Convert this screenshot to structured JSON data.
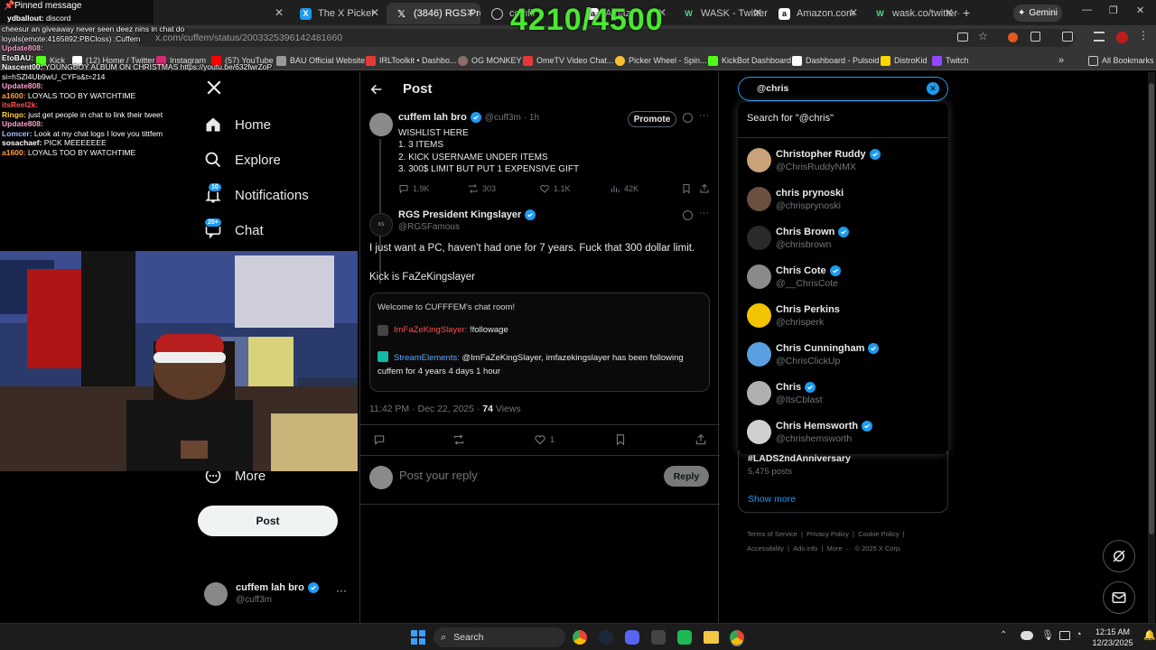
{
  "browser": {
    "tabs": [
      {
        "label": ""
      },
      {
        "label": "The X Picker"
      },
      {
        "label": "(3846) RGS Pres"
      },
      {
        "label": "coinfli"
      },
      {
        "label": "Amaz"
      },
      {
        "label": "WASK - Twitter"
      },
      {
        "label": "Amazon.com"
      },
      {
        "label": "wask.co/twitter-"
      }
    ],
    "gemini_label": "Gemini",
    "url": "x.com/cuffem/status/2003325396142481660",
    "bookmarks": [
      "Kick",
      "(12) Home / Twitter",
      "Instagram",
      "(57) YouTube",
      "BAU Official Website",
      "IRLToolkit • Dashbo...",
      "OG MONKEY",
      "OmeTV Video Chat...",
      "Picker Wheel - Spin...",
      "KickBot Dashboard",
      "Dashboard - Pulsoid",
      "DistroKid",
      "Twitch"
    ],
    "all_bookmarks": "All Bookmarks"
  },
  "overlay": {
    "counter": "4210/4500",
    "pinned_label": "Pinned message",
    "pinned_user": "ydballout:",
    "pinned_text": "discord",
    "chat": [
      {
        "user": "",
        "text": "cheesur an giveaway never seen deez nins in chat do",
        "color": "#ffffff"
      },
      {
        "user": "",
        "text": "loyals(emote:4165892:PBCloss) :Cuffem",
        "color": "#ffffff"
      },
      {
        "user": "Update808:",
        "text": "",
        "color": "#ff9fcf"
      },
      {
        "user": "EtoBAU:",
        "text": "",
        "color": "#ffffff"
      },
      {
        "user": "Nascent00:",
        "text": "YOUNGBOY ALBUM ON CHRISTMAS https://youtu.be/632fwrZoPIQ?",
        "color": "#ffffff"
      },
      {
        "user": "",
        "text": "si=hSZl4Ub9wU_CYFs&t=214",
        "color": "#ffffff"
      },
      {
        "user": "Update808:",
        "text": "",
        "color": "#ff9fcf"
      },
      {
        "user": "a1600:",
        "text": "LOYALS TOO BY WATCHTIME",
        "color": "#ff9f40"
      },
      {
        "user": "itsReel2k:",
        "text": "",
        "color": "#ff5050"
      },
      {
        "user": "Ringo:",
        "text": "just get people in chat to link their tweet",
        "color": "#ffd040"
      },
      {
        "user": "Update808:",
        "text": "",
        "color": "#ff9fcf"
      },
      {
        "user": "Lomcer:",
        "text": "Look at my chat logs I love you tittfem",
        "color": "#9fc0ff"
      },
      {
        "user": "sosachaef:",
        "text": "PICK MEEEEEEE",
        "color": "#ffffff"
      },
      {
        "user": "a1600:",
        "text": "LOYALS TOO BY WATCHTIME",
        "color": "#ff9f40"
      }
    ]
  },
  "sidebar": {
    "items": [
      {
        "label": "Home",
        "icon": "home-icon"
      },
      {
        "label": "Explore",
        "icon": "search-icon"
      },
      {
        "label": "Notifications",
        "icon": "bell-icon",
        "badge": "10"
      },
      {
        "label": "Chat",
        "icon": "chat-icon",
        "badge": "20+"
      },
      {
        "label": "More",
        "icon": "more-circle-icon"
      }
    ],
    "post_button": "Post",
    "account": {
      "name": "cuffem lah bro",
      "handle": "@cuff3m"
    }
  },
  "post": {
    "header": "Post",
    "parent": {
      "name": "cuffem lah bro",
      "handle": "@cuff3m",
      "time": "· 1h",
      "promote": "Promote",
      "lines": [
        "WISHLIST HERE",
        "1. 3 ITEMS",
        "2. KICK USERNAME UNDER ITEMS",
        "3. 300$ LIMIT BUT PUT 1 EXPENSIVE GIFT"
      ],
      "replies": "1.9K",
      "reposts": "303",
      "likes": "1.1K",
      "views": "42K"
    },
    "main": {
      "name": "RGS President Kingslayer",
      "handle": "@RGSFamous",
      "text1": "I just want a PC, haven't had one for 7 years. Fuck that 300 dollar limit.",
      "text2": "Kick is FaZeKingslayer",
      "embed": {
        "title": "Welcome to CUFFFEM's chat room!",
        "user1": "ImFaZeKingSlayer:",
        "msg1": "!followage",
        "user2": "StreamElements:",
        "msg2": "@ImFaZeKingSlayer, imfazekingslayer has been following cuffem for  4 years 4 days 1 hour"
      },
      "timestamp": "11:42 PM · Dec 22, 2025 · ",
      "views": "74",
      "views_label": "Views",
      "likes": "1"
    },
    "reply_placeholder": "Post your reply",
    "reply_button": "Reply"
  },
  "search": {
    "query": "@chris",
    "search_for": "Search for \"@chris\"",
    "results": [
      {
        "name": "Christopher Ruddy",
        "handle": "@ChrisRuddyNMX",
        "verified": true,
        "color": "#c9a27a"
      },
      {
        "name": "chris prynoski",
        "handle": "@chrisprynoski",
        "verified": false,
        "color": "#6b5040"
      },
      {
        "name": "Chris Brown",
        "handle": "@chrisbrown",
        "verified": true,
        "color": "#2a2a2a"
      },
      {
        "name": "Chris Cote",
        "handle": "@__ChrisCote",
        "verified": true,
        "color": "#8a8a8a"
      },
      {
        "name": "Chris Perkins",
        "handle": "@chrisperk",
        "verified": false,
        "color": "#f2c400"
      },
      {
        "name": "Chris Cunningham",
        "handle": "@ChrisClickUp",
        "verified": true,
        "color": "#5aa0e0"
      },
      {
        "name": "Chris",
        "handle": "@ItsCblast",
        "verified": true,
        "color": "#b0b0b0"
      },
      {
        "name": "Chris Hemsworth",
        "handle": "@chrishemsworth",
        "verified": true,
        "color": "#d0d0d0"
      }
    ],
    "trend": "#LADS2ndAnniversary",
    "trend_posts": "5,475 posts",
    "show_more": "Show more",
    "footer": [
      "Terms of Service",
      "Privacy Policy",
      "Cookie Policy",
      "Accessibility",
      "Ads info",
      "More ···",
      "© 2025 X Corp."
    ]
  },
  "taskbar": {
    "search": "Search",
    "time": "12:15 AM",
    "date": "12/23/2025"
  }
}
